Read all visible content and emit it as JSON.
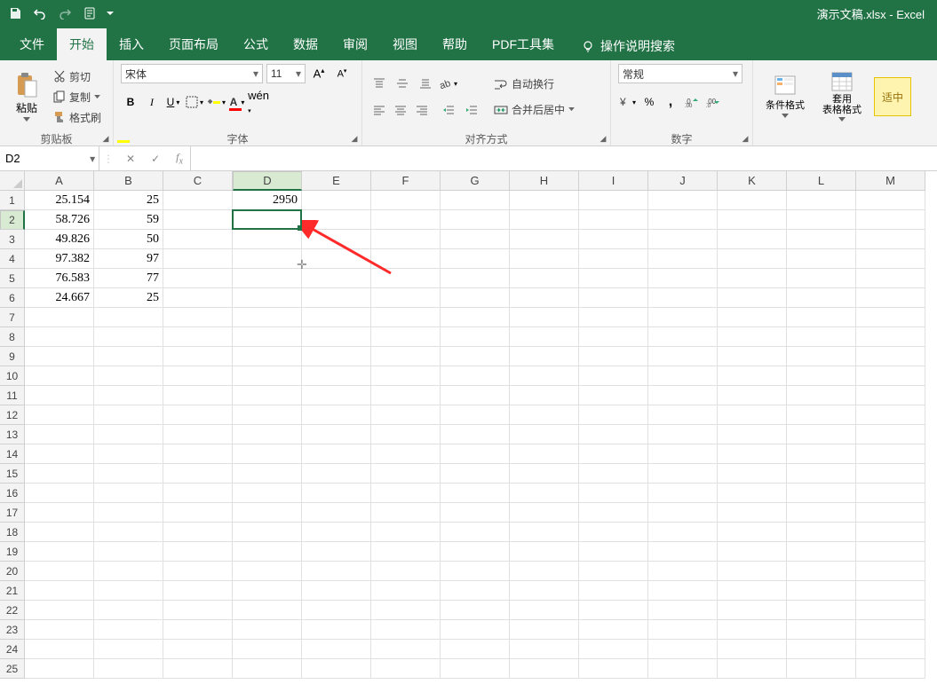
{
  "title": {
    "doc": "演示文稿.xlsx",
    "app": "Excel"
  },
  "tabs": [
    "文件",
    "开始",
    "插入",
    "页面布局",
    "公式",
    "数据",
    "审阅",
    "视图",
    "帮助",
    "PDF工具集"
  ],
  "active_tab": 1,
  "tell_me": "操作说明搜索",
  "ribbon": {
    "clipboard": {
      "paste": "粘贴",
      "cut": "剪切",
      "copy": "复制",
      "painter": "格式刷",
      "label": "剪贴板"
    },
    "font": {
      "name": "宋体",
      "size": "11",
      "label": "字体"
    },
    "alignment": {
      "wrap": "自动换行",
      "merge": "合并后居中",
      "label": "对齐方式"
    },
    "number": {
      "format": "常规",
      "label": "数字"
    },
    "styles": {
      "cond": "条件格式",
      "table": "套用\n表格格式",
      "fit": "适中"
    }
  },
  "namebox": "D2",
  "formula": "",
  "columns": [
    "A",
    "B",
    "C",
    "D",
    "E",
    "F",
    "G",
    "H",
    "I",
    "J",
    "K",
    "L",
    "M"
  ],
  "selected_col_index": 3,
  "selected_row_index": 1,
  "row_count": 25,
  "data": {
    "r1": {
      "A": "25.154",
      "B": "25",
      "D": "2950"
    },
    "r2": {
      "A": "58.726",
      "B": "59"
    },
    "r3": {
      "A": "49.826",
      "B": "50"
    },
    "r4": {
      "A": "97.382",
      "B": "97"
    },
    "r5": {
      "A": "76.583",
      "B": "77"
    },
    "r6": {
      "A": "24.667",
      "B": "25"
    }
  }
}
